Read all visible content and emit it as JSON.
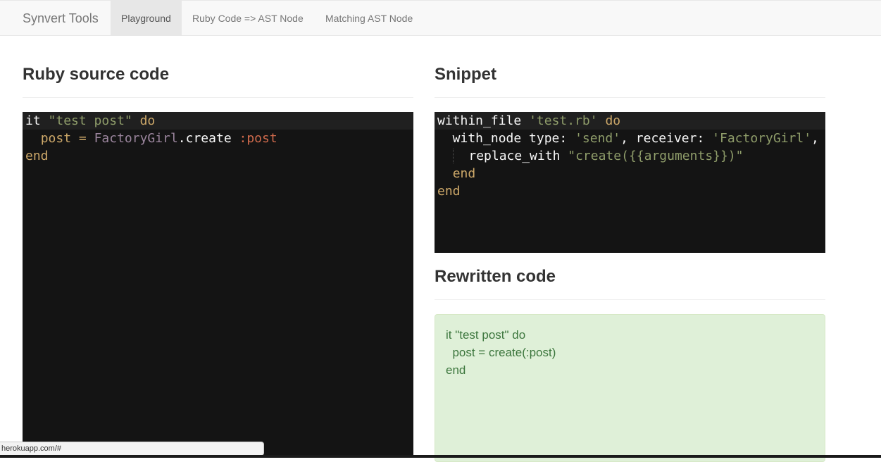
{
  "navbar": {
    "brand": "Synvert Tools",
    "items": [
      {
        "label": "Playground",
        "active": true
      },
      {
        "label": "Ruby Code => AST Node",
        "active": false
      },
      {
        "label": "Matching AST Node",
        "active": false
      }
    ]
  },
  "source": {
    "title": "Ruby source code",
    "lines": [
      [
        {
          "t": "it",
          "c": "plain"
        },
        {
          "t": " ",
          "c": "plain"
        },
        {
          "t": "\"test post\"",
          "c": "str"
        },
        {
          "t": " ",
          "c": "plain"
        },
        {
          "t": "do",
          "c": "kw"
        }
      ],
      [
        {
          "t": "  ",
          "c": "plain"
        },
        {
          "t": "post",
          "c": "kw"
        },
        {
          "t": " ",
          "c": "plain"
        },
        {
          "t": "=",
          "c": "kw"
        },
        {
          "t": " ",
          "c": "plain"
        },
        {
          "t": "FactoryGirl",
          "c": "const"
        },
        {
          "t": ".create ",
          "c": "plain"
        },
        {
          "t": ":post",
          "c": "sym"
        }
      ],
      [
        {
          "t": "end",
          "c": "kw"
        }
      ]
    ]
  },
  "snippet": {
    "title": "Snippet",
    "lines": [
      [
        {
          "t": "within_file",
          "c": "plain"
        },
        {
          "t": " ",
          "c": "plain"
        },
        {
          "t": "'test.rb'",
          "c": "str"
        },
        {
          "t": " ",
          "c": "plain"
        },
        {
          "t": "do",
          "c": "kw"
        }
      ],
      [
        {
          "t": "  with_node type: ",
          "c": "plain"
        },
        {
          "t": "'send'",
          "c": "str"
        },
        {
          "t": ", receiver: ",
          "c": "plain"
        },
        {
          "t": "'FactoryGirl'",
          "c": "str"
        },
        {
          "t": ",",
          "c": "plain"
        }
      ],
      [
        {
          "t": "  ",
          "c": "guide"
        },
        {
          "t": "  replace_with ",
          "c": "plain"
        },
        {
          "t": "\"create({{arguments}})\"",
          "c": "str"
        }
      ],
      [
        {
          "t": "  ",
          "c": "plain"
        },
        {
          "t": "end",
          "c": "kw"
        }
      ],
      [
        {
          "t": "end",
          "c": "kw"
        }
      ]
    ]
  },
  "rewritten": {
    "title": "Rewritten code",
    "lines": [
      "it \"test post\" do",
      "  post = create(:post)",
      "end"
    ]
  },
  "statusbar": {
    "url": "herokuapp.com/#"
  }
}
